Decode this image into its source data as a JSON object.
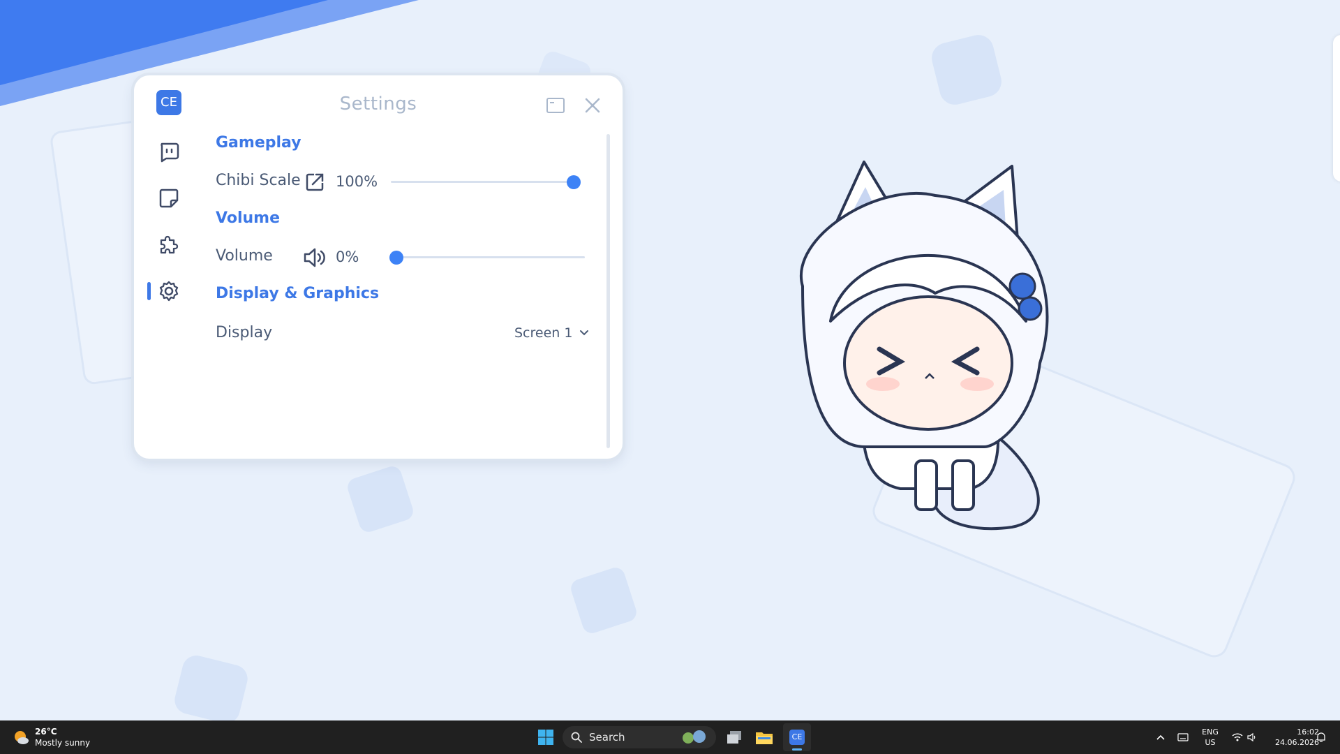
{
  "settings_window": {
    "logo_text": "CE",
    "title": "Settings",
    "sections": {
      "gameplay": {
        "heading": "Gameplay",
        "chibi_scale": {
          "label": "Chibi Scale",
          "value_text": "100%",
          "level": 1.0
        }
      },
      "volume": {
        "heading": "Volume",
        "volume": {
          "label": "Volume",
          "value_text": "0%",
          "level": 0.0
        }
      },
      "display_graphics": {
        "heading": "Display & Graphics",
        "display": {
          "label": "Display",
          "selected": "Screen 1"
        }
      }
    },
    "sidebar_icons": [
      "chat-bubble-icon",
      "sticky-note-icon",
      "puzzle-icon",
      "gear-icon"
    ],
    "accent": "#3d78e6"
  },
  "taskbar": {
    "weather": {
      "temp": "26°C",
      "condition": "Mostly sunny"
    },
    "search_placeholder": "Search",
    "lang_primary": "ENG",
    "lang_secondary": "US",
    "time": "16:02",
    "date": "24.06.2026"
  }
}
